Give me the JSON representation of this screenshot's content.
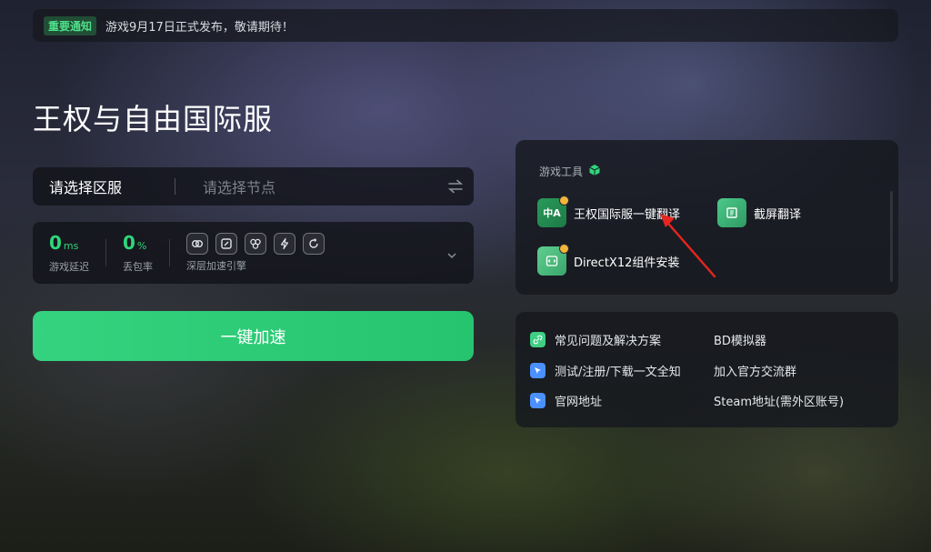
{
  "notice": {
    "tag": "重要通知",
    "text": "游戏9月17日正式发布，敬请期待！"
  },
  "game": {
    "title": "王权与自由国际服"
  },
  "server": {
    "region_label": "请选择区服",
    "node_placeholder": "请选择节点"
  },
  "stats": {
    "latency_value": "0",
    "latency_unit": "ms",
    "latency_label": "游戏延迟",
    "loss_value": "0",
    "loss_unit": "%",
    "loss_label": "丢包率",
    "engine_label": "深层加速引擎"
  },
  "accelerate_button": "一键加速",
  "tools": {
    "title": "游戏工具",
    "items": [
      {
        "label": "王权国际服一键翻译",
        "icon": "translate-icon",
        "icon_text": "中A"
      },
      {
        "label": "截屏翻译",
        "icon": "screenshot-translate-icon"
      },
      {
        "label": "DirectX12组件安装",
        "icon": "directx-install-icon"
      }
    ]
  },
  "links": [
    {
      "label": "常见问题及解决方案",
      "icon": "link-icon"
    },
    {
      "label": "BD模拟器"
    },
    {
      "label": "测试/注册/下载一文全知",
      "icon": "cursor-click-icon"
    },
    {
      "label": "加入官方交流群"
    },
    {
      "label": "官网地址",
      "icon": "cursor-click-icon"
    },
    {
      "label": "Steam地址(需外区账号)"
    }
  ],
  "colors": {
    "accent": "#2fd67a",
    "button": "#2ecb75",
    "badge": "#f4b43a"
  }
}
